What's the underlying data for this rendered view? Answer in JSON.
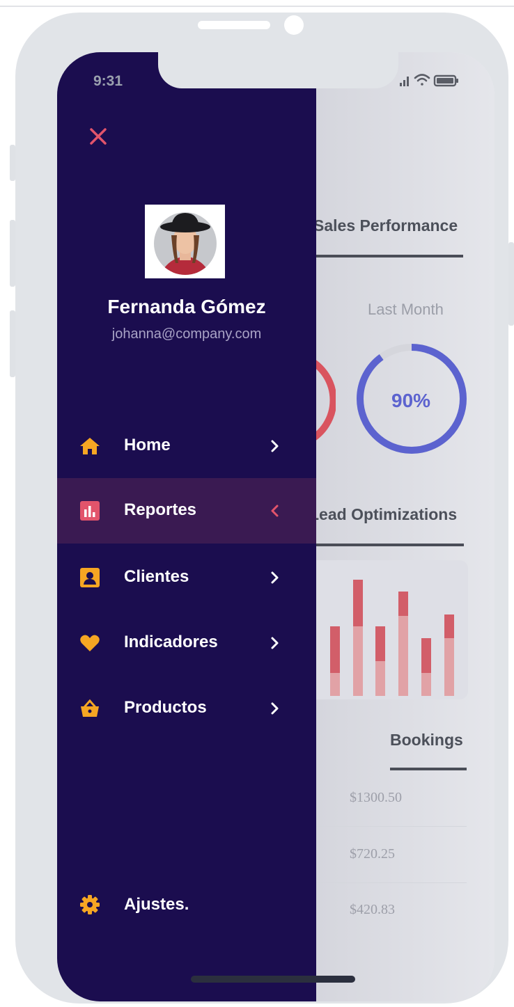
{
  "status": {
    "time": "9:31"
  },
  "profile": {
    "name": "Fernanda Gómez",
    "email": "johanna@company.com"
  },
  "menu": {
    "items": [
      {
        "label": "Home",
        "icon": "home-icon",
        "active": false
      },
      {
        "label": "Reportes",
        "icon": "bar-chart-icon",
        "active": true
      },
      {
        "label": "Clientes",
        "icon": "contact-card-icon",
        "active": false
      },
      {
        "label": "Indicadores",
        "icon": "heart-icon",
        "active": false
      },
      {
        "label": "Productos",
        "icon": "basket-icon",
        "active": false
      }
    ],
    "settings_label": "Ajustes."
  },
  "background": {
    "sales_performance_title": "Sales Performance",
    "last_month_label": "Last Month",
    "last_month_value": "90%",
    "last_month_progress": 0.9,
    "lead_optimizations_title": "Lead Optimizations",
    "bookings_title": "Bookings",
    "bookings_amounts": [
      "$1300.50",
      "$720.25",
      "$420.83"
    ]
  },
  "colors": {
    "drawer_bg": "#1b0d4f",
    "active_item_bg": "#3a1a52",
    "icon_accent": "#f6a623",
    "reportes_icon": "#e2546b",
    "close_icon": "#e2546b",
    "ring_blue": "#5c63cf",
    "ring_red": "#d9545f"
  }
}
